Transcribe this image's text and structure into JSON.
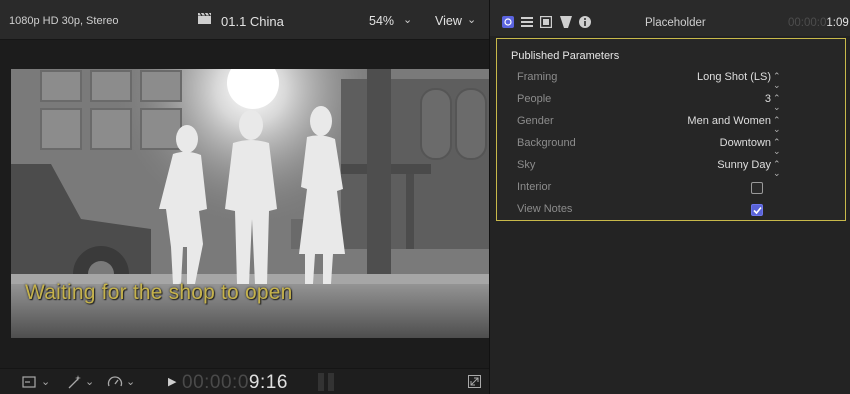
{
  "viewer": {
    "format": "1080p HD 30p, Stereo",
    "clip_name": "01.1 China",
    "zoom": "54%",
    "view_label": "View",
    "subtitle": "Waiting for the shop to open",
    "timecode_dim": "00:00:0",
    "timecode_bright": "9:16"
  },
  "inspector": {
    "title": "Placeholder",
    "timecode_dim": "00:00:0",
    "timecode_bright": "1:09",
    "section_title": "Published Parameters",
    "params": [
      {
        "label": "Framing",
        "value": "Long Shot (LS)"
      },
      {
        "label": "People",
        "value": "3"
      },
      {
        "label": "Gender",
        "value": "Men and Women"
      },
      {
        "label": "Background",
        "value": "Downtown"
      },
      {
        "label": "Sky",
        "value": "Sunny Day"
      },
      {
        "label": "Interior",
        "checked": false
      },
      {
        "label": "View Notes",
        "checked": true
      }
    ]
  },
  "colors": {
    "accent_checkbox": "#5a63d8",
    "section_border": "#c8b94a",
    "subtitle_text": "#c5b24c"
  }
}
